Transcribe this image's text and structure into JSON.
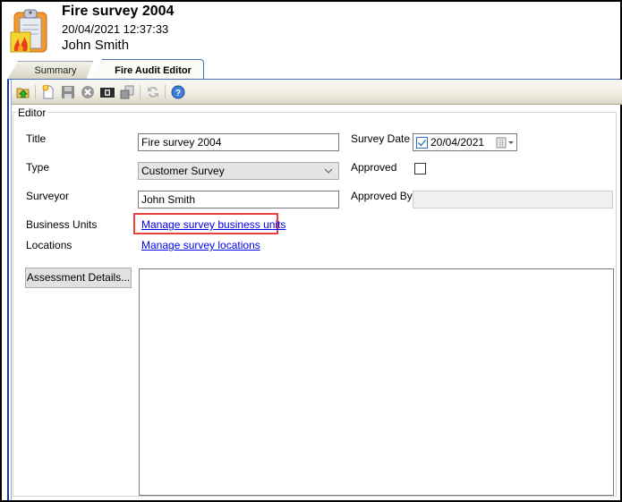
{
  "header": {
    "title": "Fire survey 2004",
    "datetime": "20/04/2021 12:37:33",
    "user": "John Smith",
    "icon": "fire-survey-clipboard-icon"
  },
  "tabs": [
    {
      "label": "Summary",
      "active": false
    },
    {
      "label": "Fire Audit Editor",
      "active": true
    }
  ],
  "toolbar": {
    "buttons": [
      {
        "name": "open-folder-icon",
        "tooltip": "Open",
        "enabled": true
      },
      {
        "name": "new-document-icon",
        "tooltip": "New",
        "enabled": true
      },
      {
        "name": "save-icon",
        "tooltip": "Save",
        "enabled": false
      },
      {
        "name": "delete-icon",
        "tooltip": "Delete",
        "enabled": false
      },
      {
        "name": "camera-icon",
        "tooltip": "Capture",
        "enabled": true
      },
      {
        "name": "copy-icon",
        "tooltip": "Copy",
        "enabled": false
      },
      {
        "name": "refresh-icon",
        "tooltip": "Refresh",
        "enabled": false
      },
      {
        "name": "help-icon",
        "tooltip": "Help",
        "enabled": true
      }
    ]
  },
  "editor": {
    "group_label": "Editor",
    "title_label": "Title",
    "title_value": "Fire survey 2004",
    "type_label": "Type",
    "type_value": "Customer Survey",
    "surveyor_label": "Surveyor",
    "surveyor_value": "John Smith",
    "business_units_label": "Business Units",
    "business_units_link": "Manage survey business units",
    "locations_label": "Locations",
    "locations_link": "Manage survey locations",
    "survey_date_label": "Survey Date",
    "survey_date_value": "20/04/2021",
    "survey_date_checked": true,
    "approved_label": "Approved",
    "approved_checked": false,
    "approved_by_label": "Approved By",
    "approved_by_value": "",
    "assessment_button": "Assessment Details...",
    "assessment_text": ""
  },
  "colors": {
    "highlight": "#e8403a",
    "link": "#0000ee",
    "tab_border": "#4a6fb0"
  }
}
